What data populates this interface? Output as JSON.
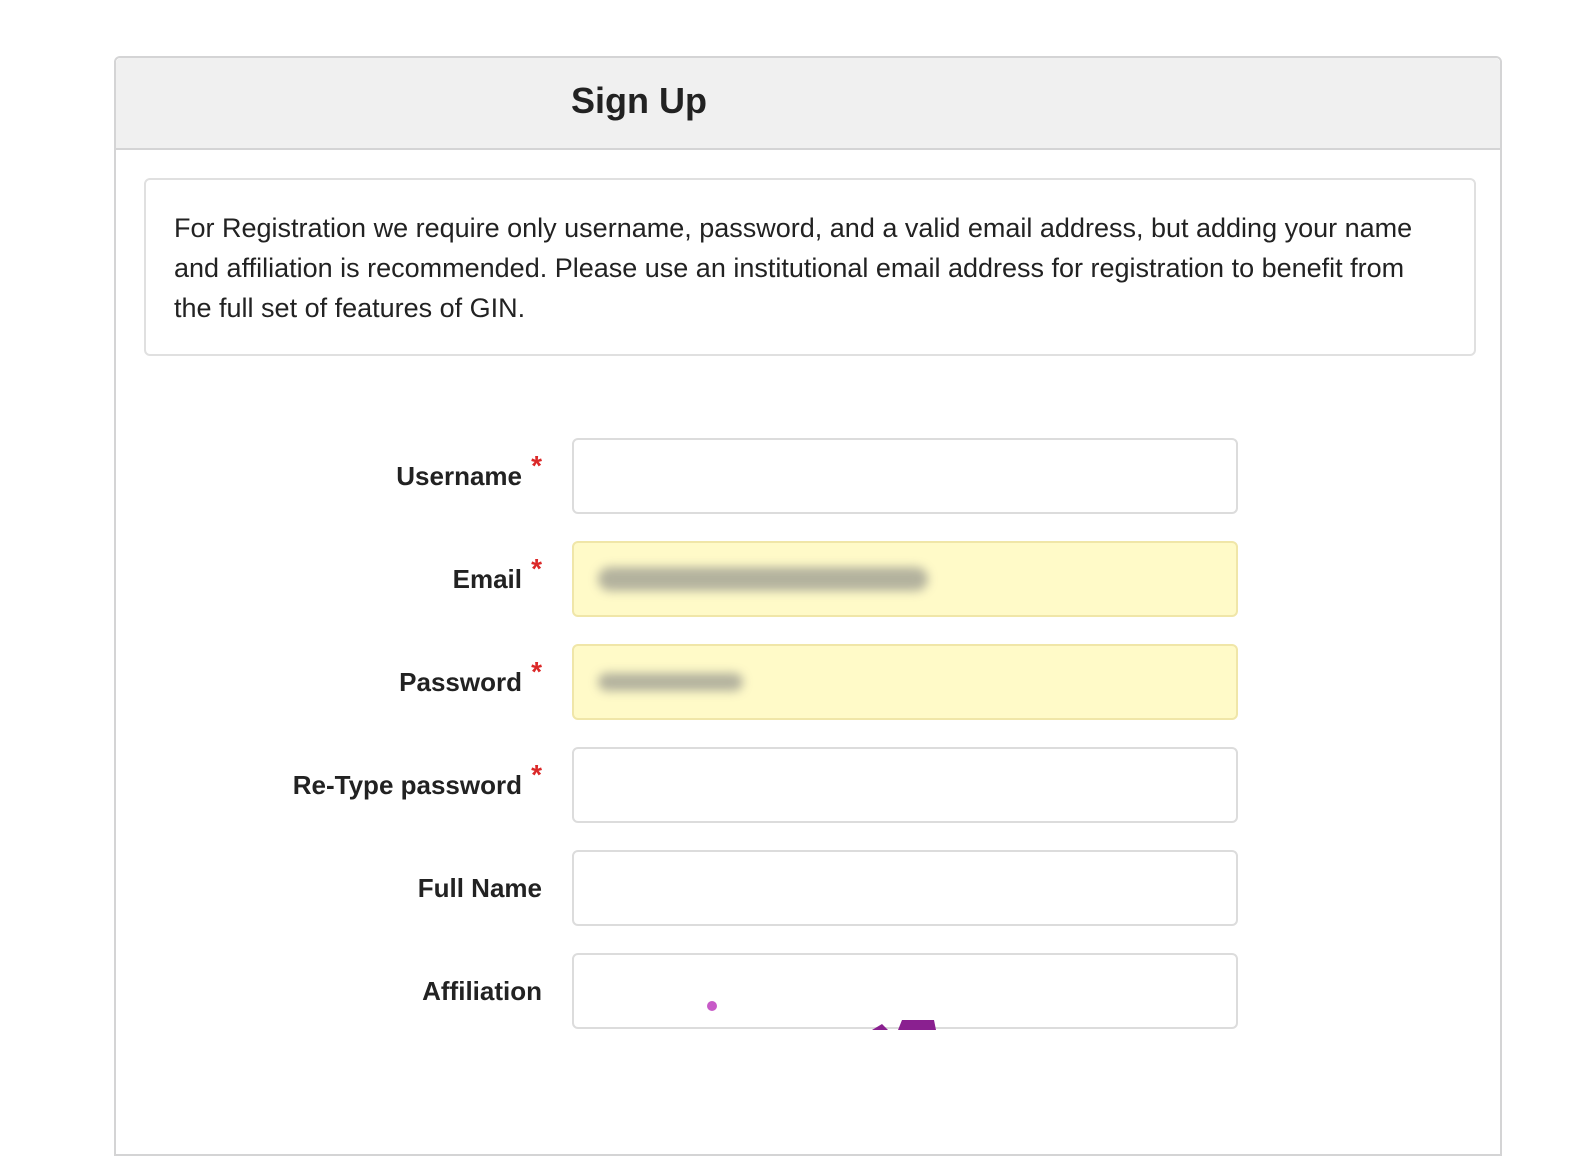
{
  "header": {
    "title": "Sign Up"
  },
  "notice": {
    "text": "For Registration we require only username, password, and a valid email address, but adding your name and affiliation is recommended. Please use an institutional email address for registration to benefit from the full set of features of GIN."
  },
  "form": {
    "required_marker": "*",
    "fields": [
      {
        "label": "Username",
        "required": true,
        "value": "",
        "autofilled": false
      },
      {
        "label": "Email",
        "required": true,
        "value": "",
        "autofilled": true,
        "blurred": true
      },
      {
        "label": "Password",
        "required": true,
        "value": "",
        "autofilled": true,
        "blurred": true
      },
      {
        "label": "Re-Type password",
        "required": true,
        "value": "",
        "autofilled": false
      },
      {
        "label": "Full Name",
        "required": false,
        "value": "",
        "autofilled": false
      },
      {
        "label": "Affiliation",
        "required": false,
        "value": "",
        "autofilled": false
      }
    ]
  },
  "colors": {
    "header_bg": "#f0f0f0",
    "autofill_bg": "#fffac8",
    "required_star": "#db2828",
    "captcha_dots": "#c85ac8"
  }
}
